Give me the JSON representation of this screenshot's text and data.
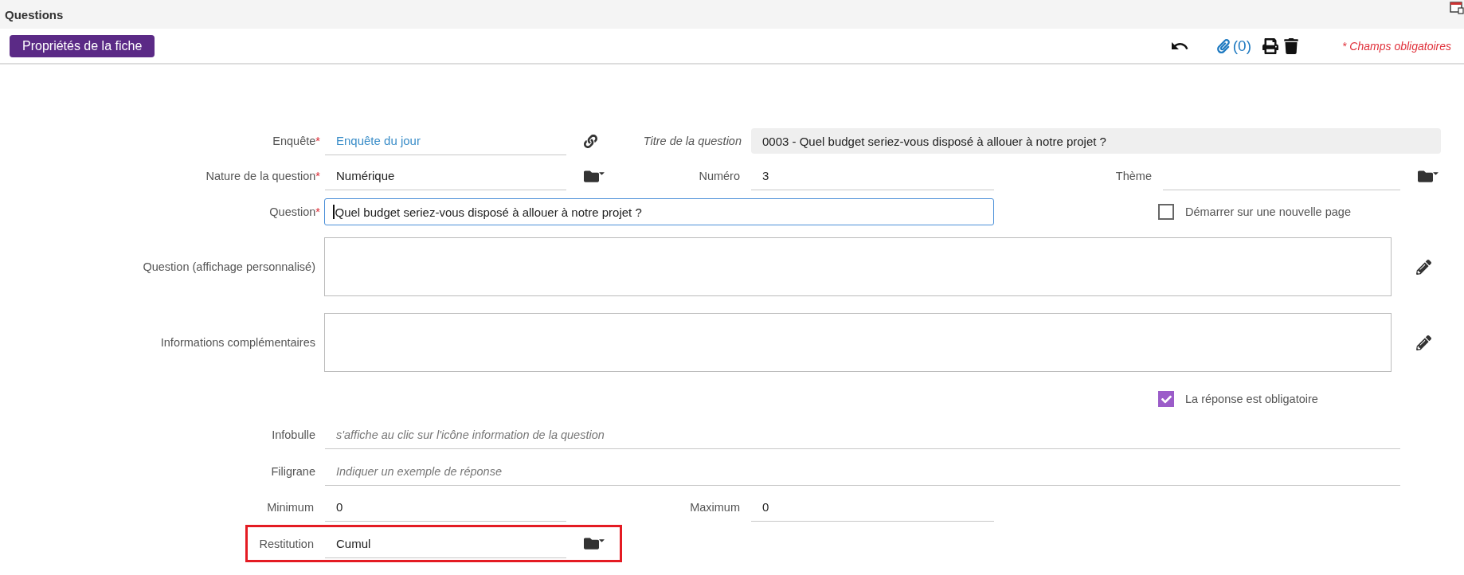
{
  "title": "Questions",
  "toolbar": {
    "button": "Propriétés de la fiche",
    "attachments": "(0)",
    "required_note": "* Champs obligatoires"
  },
  "rows": [
    {
      "items": [
        {
          "kind": "link",
          "label": "Enquête",
          "mark": "*",
          "value": "Enquête du jour"
        },
        {
          "kind": "readonly",
          "label": "Titre de la question",
          "value": "0003 - Quel budget seriez-vous disposé à allouer à notre projet ?"
        }
      ]
    },
    {
      "items": [
        {
          "kind": "select",
          "label": "Nature de la question",
          "mark": "*",
          "value": "Numérique"
        },
        {
          "kind": "text",
          "label": "Numéro",
          "value": "3"
        },
        {
          "kind": "select",
          "label": "Thème"
        }
      ]
    },
    {
      "items": [
        {
          "kind": "input",
          "label": "Question",
          "mark": "*",
          "value": "Quel budget seriez-vous disposé à allouer à notre projet ?"
        },
        {
          "kind": "checkbox",
          "label": "Démarrer sur une nouvelle page",
          "checked": false
        }
      ]
    },
    {
      "items": [
        {
          "kind": "textarea",
          "label": "Question (affichage personnalisé)"
        }
      ]
    },
    {
      "items": [
        {
          "kind": "textarea",
          "label": "Informations complémentaires"
        }
      ]
    },
    {
      "items": [
        {
          "kind": "checkbox",
          "label": "La réponse est obligatoire",
          "checked": true
        }
      ]
    },
    {
      "items": [
        {
          "kind": "wide",
          "label": "Infobulle",
          "placeholder": "s'affiche au clic sur l'icône information de la question"
        }
      ]
    },
    {
      "items": [
        {
          "kind": "wide",
          "label": "Filigrane",
          "placeholder": "Indiquer un exemple de réponse"
        }
      ]
    },
    {
      "items": [
        {
          "kind": "text",
          "label": "Minimum",
          "value": "0"
        },
        {
          "kind": "text",
          "label": "Maximum",
          "value": "0"
        }
      ]
    },
    {
      "highlighted": true,
      "items": [
        {
          "kind": "select",
          "label": "Restitution",
          "value": "Cumul"
        }
      ]
    }
  ]
}
